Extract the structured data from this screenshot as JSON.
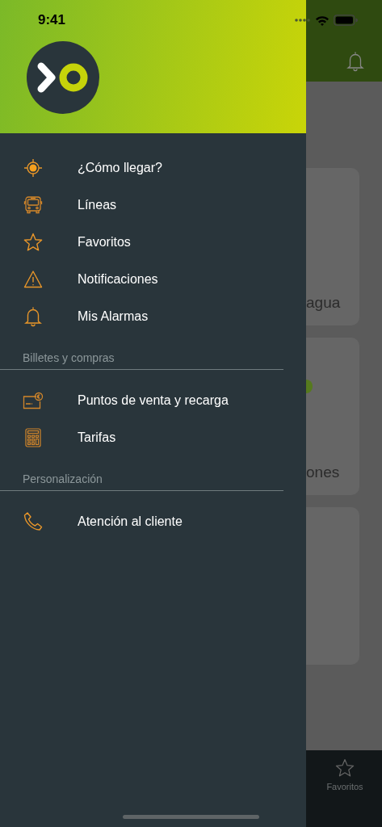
{
  "status_bar": {
    "time": "9:41"
  },
  "drawer": {
    "sections": [
      {
        "items": [
          {
            "label": "¿Cómo llegar?",
            "kind": "locate"
          },
          {
            "label": "Líneas",
            "kind": "bus"
          },
          {
            "label": "Favoritos",
            "kind": "star"
          },
          {
            "label": "Notificaciones",
            "kind": "warning"
          },
          {
            "label": "Mis Alarmas",
            "kind": "bell"
          }
        ]
      },
      {
        "title": "Billetes y compras",
        "items": [
          {
            "label": "Puntos de venta y recarga",
            "kind": "card"
          },
          {
            "label": "Tarifas",
            "kind": "calculator"
          }
        ]
      },
      {
        "title": "Personalización",
        "items": [
          {
            "label": "Atención al cliente",
            "kind": "phone"
          }
        ]
      }
    ]
  },
  "background": {
    "cards": [
      {
        "text": "agua",
        "dot": false
      },
      {
        "text": "ones",
        "dot": true
      },
      {
        "dot": false
      }
    ]
  },
  "tab_bar": {
    "tabs": [
      {
        "label": "Favoritos"
      }
    ]
  }
}
